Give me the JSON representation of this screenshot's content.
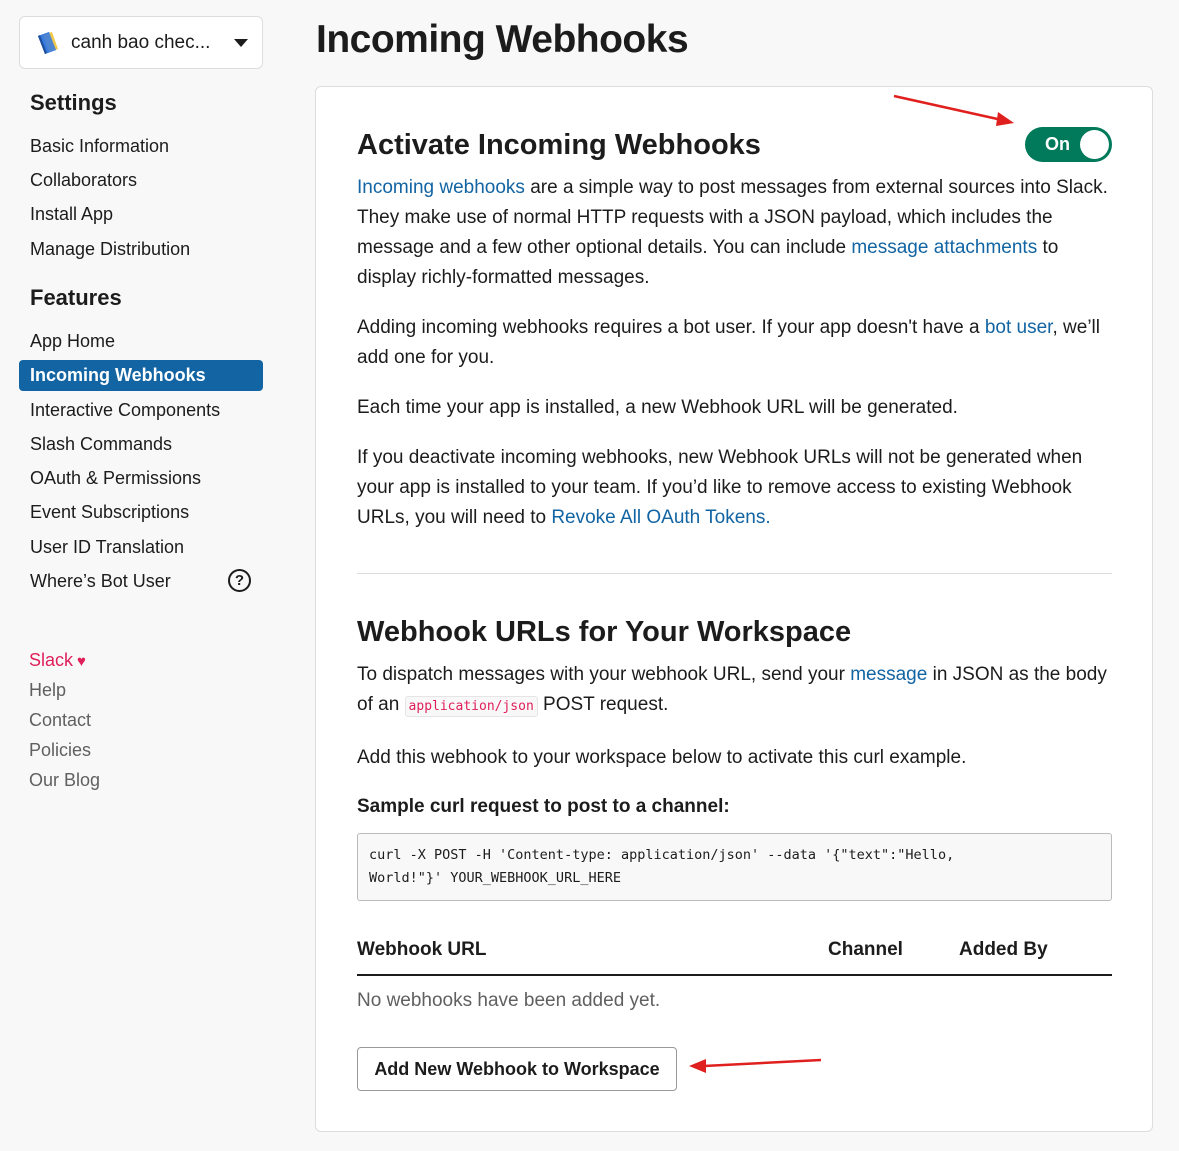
{
  "sidebar": {
    "app_name": "canh bao chec...",
    "settings_heading": "Settings",
    "settings_items": [
      {
        "label": "Basic Information"
      },
      {
        "label": "Collaborators"
      },
      {
        "label": "Install App"
      },
      {
        "label": "Manage Distribution"
      }
    ],
    "features_heading": "Features",
    "features_items": [
      {
        "label": "App Home"
      },
      {
        "label": "Incoming Webhooks",
        "active": true
      },
      {
        "label": "Interactive Components"
      },
      {
        "label": "Slash Commands"
      },
      {
        "label": "OAuth & Permissions"
      },
      {
        "label": "Event Subscriptions"
      },
      {
        "label": "User ID Translation"
      },
      {
        "label": "Where’s Bot User"
      }
    ],
    "help_glyph": "?",
    "footer_links": [
      {
        "label": "Slack"
      },
      {
        "label": "Help"
      },
      {
        "label": "Contact"
      },
      {
        "label": "Policies"
      },
      {
        "label": "Our Blog"
      }
    ],
    "heart_glyph": "♥"
  },
  "main": {
    "page_title": "Incoming Webhooks",
    "activate": {
      "heading": "Activate Incoming Webhooks",
      "toggle_label": "On",
      "toggle_state": "on",
      "p1": {
        "link1": "Incoming webhooks",
        "text1": " are a simple way to post messages from external sources into Slack. They make use of normal HTTP requests with a JSON payload, which includes the message and a few other optional details. You can include ",
        "link2": "message attachments",
        "text2": " to display richly-formatted messages."
      },
      "p2": {
        "text1": "Adding incoming webhooks requires a bot user. If your app doesn't have a ",
        "link": "bot user",
        "text2": ", we’ll add one for you."
      },
      "p3": "Each time your app is installed, a new Webhook URL will be generated.",
      "p4": {
        "text1": "If you deactivate incoming webhooks, new Webhook URLs will not be generated when your app is installed to your team. If you’d like to remove access to existing Webhook URLs, you will need to ",
        "link": "Revoke All OAuth Tokens."
      }
    },
    "workspace": {
      "heading": "Webhook URLs for Your Workspace",
      "p1": {
        "text1": "To dispatch messages with your webhook URL, send your ",
        "link": "message",
        "text2": " in JSON as the body of an ",
        "code": "application/json",
        "text3": " POST request."
      },
      "p2": "Add this webhook to your workspace below to activate this curl example.",
      "sample_label": "Sample curl request to post to a channel:",
      "curl_line1": "curl -X POST -H 'Content-type: application/json' --data '{\"text\":\"Hello,",
      "curl_line2": "World!\"}' YOUR_WEBHOOK_URL_HERE",
      "table_headers": [
        "Webhook URL",
        "Channel",
        "Added By"
      ],
      "empty_text": "No webhooks have been added yet.",
      "add_button": "Add New Webhook to Workspace"
    }
  },
  "colors": {
    "accent": "#1264a3",
    "toggle_on": "#007a5a",
    "slack_pink": "#e01e5a",
    "annotation_arrow": "#e0201e"
  }
}
